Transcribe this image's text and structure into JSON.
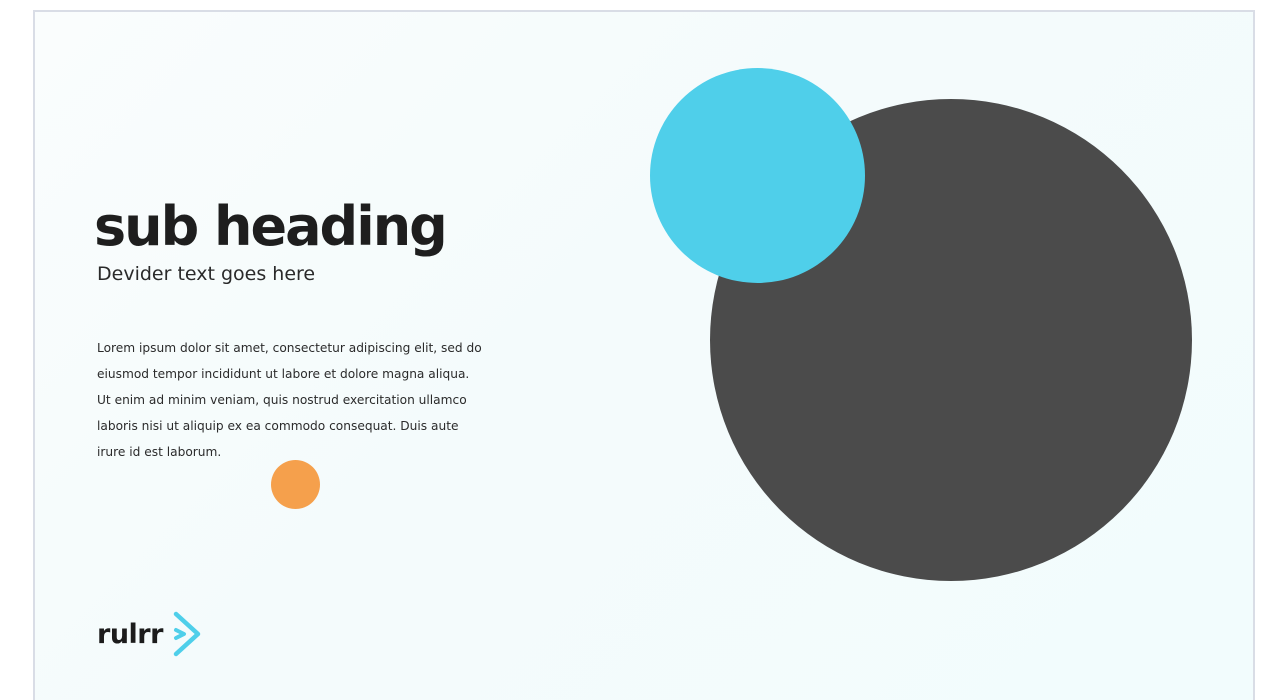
{
  "slide": {
    "heading": "sub heading",
    "divider_text": "Devider text goes here",
    "body": "Lorem ipsum dolor sit amet, consectetur adipiscing elit, sed do\neiusmod tempor incididunt ut labore et dolore magna aliqua.\nUt enim ad minim veniam, quis nostrud exercitation ullamco\nlaboris nisi ut aliquip ex ea commodo consequat. Duis aute\nirure  id est laborum."
  },
  "logo": {
    "text": "rulrr",
    "icon": "chevron-arrow-icon"
  },
  "colors": {
    "accent_blue": "#4fcfea",
    "dark_circle": "#4b4b4b",
    "accent_orange": "#f5a04c",
    "text": "#1e1e1e"
  }
}
